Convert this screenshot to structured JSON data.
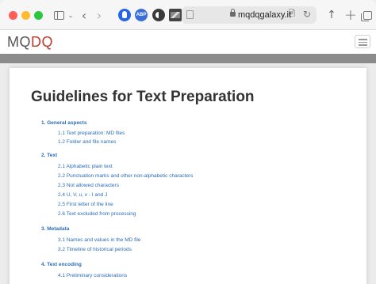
{
  "browser": {
    "url": "mqdqgalaxy.it",
    "translate_glyph": "↑̀́",
    "reload_glyph": "↻",
    "back_glyph": "‹",
    "forward_glyph": "›",
    "share_glyph": "↑",
    "newtab_glyph": "+",
    "chevron_glyph": "⌄",
    "ext2_text": "ABP"
  },
  "site": {
    "logo_left": "MQ",
    "logo_mid": "D",
    "logo_right": "Q"
  },
  "page": {
    "title": "Guidelines for Text Preparation"
  },
  "toc": [
    {
      "label": "1. General aspects",
      "items": [
        "1.1 Text preparation: MD files",
        "1.2 Folder and file names"
      ]
    },
    {
      "label": "2. Text",
      "items": [
        "2.1 Alphabetic plain text",
        "2.2 Punctuation marks and other non-alphabetic characters",
        "2.3 Not allowed characters",
        "2.4 U, V, u, v - I and J",
        "2.5 First letter of the line",
        "2.6 Text excluded from processing"
      ]
    },
    {
      "label": "3. Metadata",
      "items": [
        "3.1 Names and values in the MD file",
        "3.2 Timeline of historical periods"
      ]
    },
    {
      "label": "4. Text encoding",
      "items": [
        "4.1 Preliminary considerations"
      ]
    }
  ],
  "colors": {
    "link": "#2c6db5",
    "logo_accent": "#c0392b"
  }
}
